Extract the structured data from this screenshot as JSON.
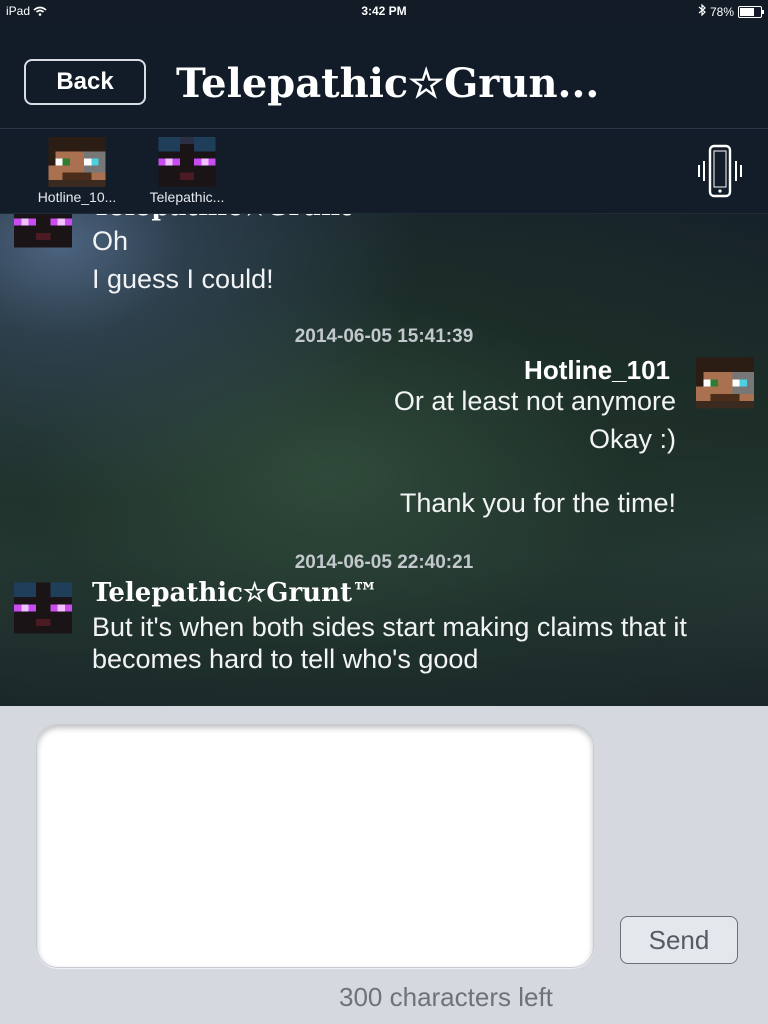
{
  "statusbar": {
    "device": "iPad",
    "time": "3:42 PM",
    "battery": "78%",
    "battery_level": 0.78
  },
  "navbar": {
    "back_label": "Back",
    "title": "Telepathic☆Grun..."
  },
  "participants": [
    {
      "label": "Hotline_10...",
      "icon": "player-avatar-hotline"
    },
    {
      "label": "Telepathic...",
      "icon": "player-avatar-telepathic"
    }
  ],
  "chat": {
    "partial_sender": "Telepathic☆Grunt",
    "first_lines": [
      "Oh",
      "I guess I could!"
    ],
    "stamp1": "2014-06-05 15:41:39",
    "hotline": {
      "name": "Hotline_101",
      "lines": [
        "Or at least not anymore",
        "Okay :)",
        "Thank you for the time!"
      ]
    },
    "stamp2": "2014-06-05 22:40:21",
    "telepathic": {
      "name": "Telepathic☆Grunt™",
      "lines": [
        "But it's when both sides start making claims that it",
        "becomes hard to tell who's good"
      ]
    }
  },
  "composer": {
    "input_value": "",
    "send_label": "Send",
    "chars_left": "300 characters left"
  },
  "colors": {
    "nav_bg": "#121c28",
    "composer_bg": "#d5d9df"
  }
}
